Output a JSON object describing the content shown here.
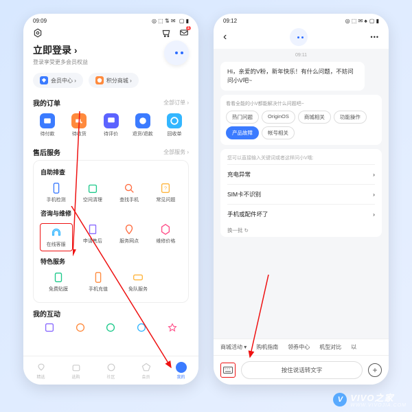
{
  "left": {
    "status": {
      "time": "09:09",
      "icons": "◎ ⬚ ⇅ ✉",
      "batt": "▢ ▮"
    },
    "header": {
      "gear": "gear",
      "cart": "cart",
      "msg_badge": "1"
    },
    "login": {
      "title": "立即登录 ›",
      "sub": "登录享受更多会员权益"
    },
    "pills": [
      {
        "label": "会员中心 ›",
        "color": "blue"
      },
      {
        "label": "积分商城 ›",
        "color": "orange"
      }
    ],
    "orders": {
      "title": "我的订单",
      "more": "全部订单 ›",
      "items": [
        {
          "label": "待付款",
          "color": "#3b7bff"
        },
        {
          "label": "待收货",
          "color": "#ff8a3d"
        },
        {
          "label": "待评价",
          "color": "#5b63ff"
        },
        {
          "label": "退货/退款",
          "color": "#3b7bff"
        },
        {
          "label": "回收单",
          "color": "#33b6ff"
        }
      ]
    },
    "aftersale": {
      "title": "售后服务",
      "more": "全部服务 ›",
      "groups": [
        {
          "sub": "自助排查",
          "items": [
            {
              "label": "手机检测",
              "color": "#3b7bff"
            },
            {
              "label": "空间清理",
              "color": "#1cc98a"
            },
            {
              "label": "查找手机",
              "color": "#ff6a3d"
            },
            {
              "label": "常见问题",
              "color": "#ffb53d"
            }
          ]
        },
        {
          "sub": "咨询与维修",
          "items": [
            {
              "label": "在线客服",
              "color": "#33b6ff",
              "hl": true
            },
            {
              "label": "申请售后",
              "color": "#8a6bff"
            },
            {
              "label": "服务网点",
              "color": "#ff6a3d"
            },
            {
              "label": "维修价格",
              "color": "#ff4d88"
            }
          ]
        },
        {
          "sub": "特色服务",
          "items": [
            {
              "label": "免费贴膜",
              "color": "#1cc98a"
            },
            {
              "label": "手机充值",
              "color": "#ff8a3d"
            },
            {
              "label": "免队服务",
              "color": "#ffb53d"
            }
          ]
        }
      ]
    },
    "interact": {
      "title": "我的互动",
      "items": [
        {
          "color": "#8a6bff"
        },
        {
          "color": "#ff8a3d"
        },
        {
          "color": "#1cc98a"
        },
        {
          "color": "#33b6ff"
        },
        {
          "color": "#ff4d88"
        }
      ]
    },
    "nav": [
      {
        "label": "精选"
      },
      {
        "label": "选购"
      },
      {
        "label": "社区"
      },
      {
        "label": "会员"
      },
      {
        "label": "我的",
        "active": true
      }
    ]
  },
  "right": {
    "status": {
      "time": "09:12",
      "icons": "◎ ⬚ ✉ ♠",
      "batt": "▢ ▮"
    },
    "chat": {
      "ts": "09:11",
      "greeting": "Hi，亲爱的V粉，新年快乐！有什么问题，不妨问问小V吧~",
      "cat_hint": "看看全能的小V都能解决什么问题吧~",
      "chips": [
        {
          "label": "热门问题"
        },
        {
          "label": "OriginOS"
        },
        {
          "label": "商城相关"
        },
        {
          "label": "功能操作"
        },
        {
          "label": "产品故障",
          "active": true
        },
        {
          "label": "帐号相关"
        }
      ],
      "faq_hint": "您可以直接输入关键词或者这样问小V哦:",
      "faqs": [
        "充电异常",
        "SIM卡不识别",
        "手机或配件坏了"
      ],
      "refresh": "换一批 ↻",
      "tags": [
        "商城活动 ▾",
        "购机指南",
        "领券中心",
        "机型对比",
        "以"
      ],
      "voice": "按住说话转文字"
    }
  },
  "watermark": {
    "brand": "VIVO之家",
    "url": "WWW.VIVOJIA.COM"
  }
}
